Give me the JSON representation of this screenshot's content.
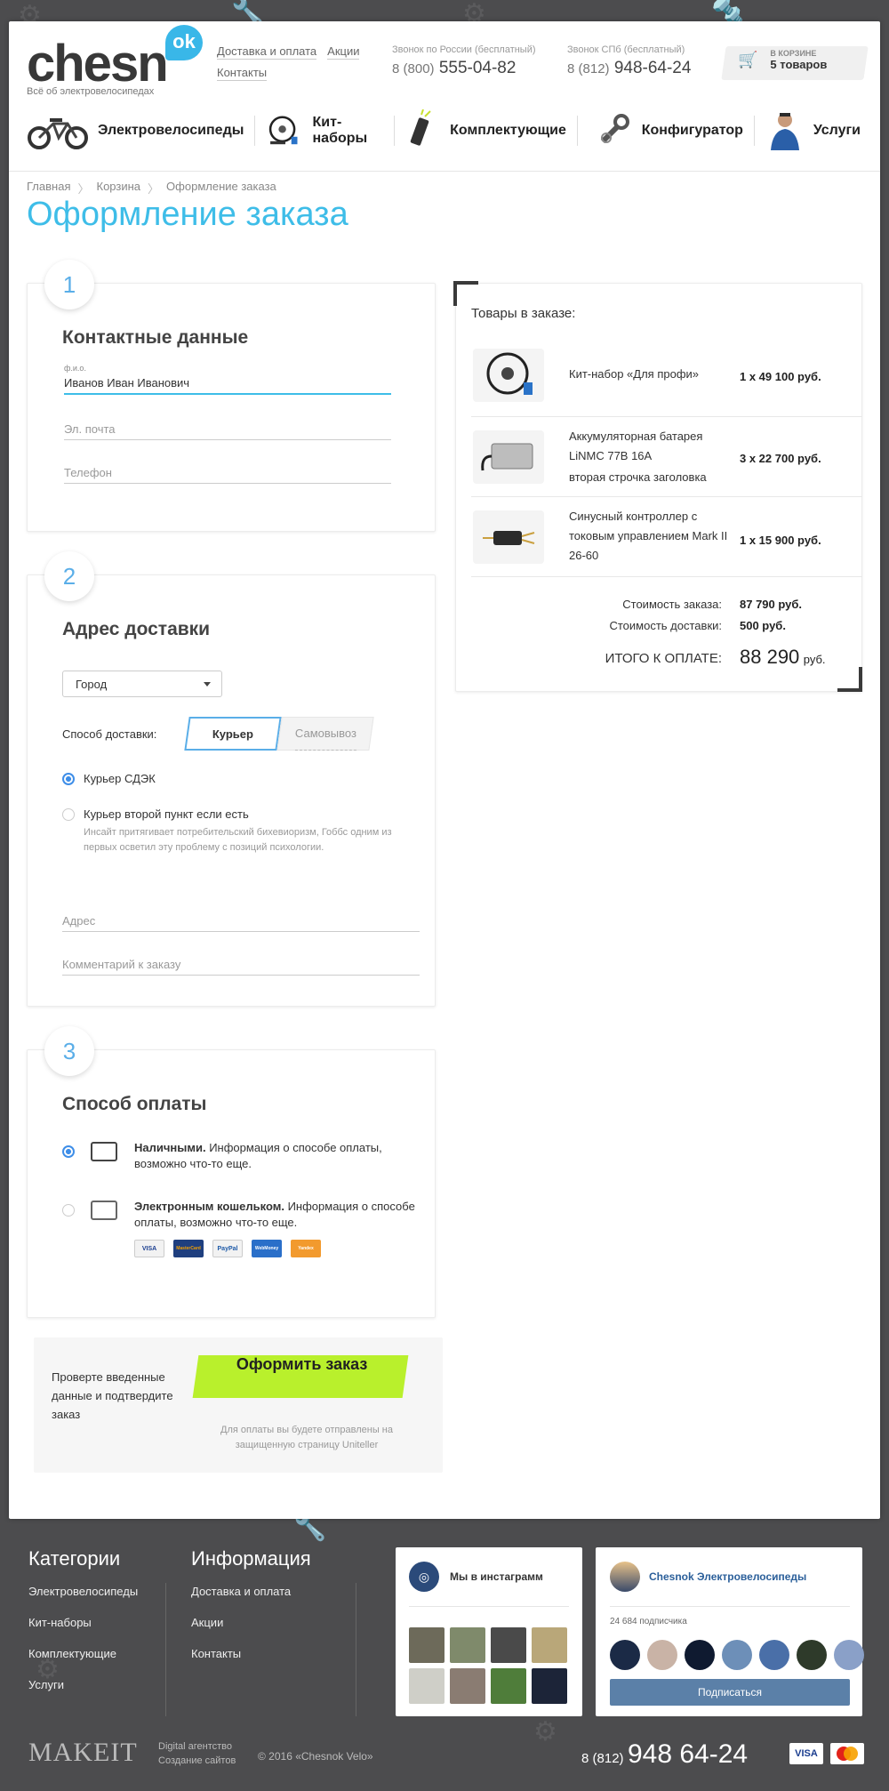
{
  "header": {
    "logo": "chesn",
    "logo_badge": "ok",
    "tagline": "Всё об электровелосипедах",
    "links": [
      "Доставка и оплата",
      "Акции",
      "Контакты"
    ],
    "phone1_caption": "Звонок по России (бесплатный)",
    "phone1_prefix": "8 (800)",
    "phone1_number": "555-04-82",
    "phone2_caption": "Звонок СПб (бесплатный)",
    "phone2_prefix": "8 (812)",
    "phone2_number": "948-64-24",
    "cart_caption": "в корзине",
    "cart_count": "5 товаров"
  },
  "nav": [
    {
      "label": "Электровелосипеды",
      "icon": "bike-icon"
    },
    {
      "label": "Кит-наборы",
      "icon": "motor-wheel-icon"
    },
    {
      "label": "Комплектующие",
      "icon": "battery-icon"
    },
    {
      "label": "Конфигуратор",
      "icon": "wrench-icon"
    },
    {
      "label": "Услуги",
      "icon": "mechanic-icon"
    }
  ],
  "breadcrumb": [
    "Главная",
    "Корзина",
    "Оформление заказа"
  ],
  "page_title": "Оформление заказа",
  "step1": {
    "num": "1",
    "title": "Контактные данные",
    "name_label": "ф.и.о.",
    "name_value": "Иванов Иван Иванович",
    "email_placeholder": "Эл. почта",
    "phone_placeholder": "Телефон"
  },
  "step2": {
    "num": "2",
    "title": "Адрес доставки",
    "city_select": "Город",
    "delivery_label": "Способ доставки:",
    "delivery_options": [
      "Курьер",
      "Самовывоз"
    ],
    "radio1": "Курьер СДЭК",
    "radio2": "Курьер второй пункт если есть",
    "radio2_desc": "Инсайт притягивает потребительский бихевиоризм, Гоббс одним из первых осветил эту проблему с позиций психологии.",
    "address_placeholder": "Адрес",
    "comment_placeholder": "Комментарий к заказу"
  },
  "step3": {
    "num": "3",
    "title": "Способ оплаты",
    "opt1_bold": "Наличными.",
    "opt1_text": " Информация о способе оплаты, возможно что-то еще.",
    "opt2_bold": "Электронным кошельком.",
    "opt2_text": " Информация о способе оплаты, возможно что-то еще.",
    "pay_logos": [
      "VISA",
      "MasterCard",
      "PayPal",
      "WebMoney",
      "Yandex"
    ]
  },
  "order": {
    "title": "Товары в заказе:",
    "items": [
      {
        "name": "Кит-набор «Для профи»",
        "price": "1 x 49 100 руб."
      },
      {
        "name": "Аккумуляторная батарея LiNMC 77В 16А",
        "name2": "вторая строчка заголовка",
        "price": "3 x 22 700 руб."
      },
      {
        "name": "Синусный контроллер с токовым управлением Mark II 26-60",
        "price": "1 x 15 900 руб."
      }
    ],
    "cost_label": "Стоимость заказа:",
    "cost_value": "87 790 руб.",
    "delivery_label": "Стоимость доставки:",
    "delivery_value": "500 руб.",
    "total_label": "ИТОГО К ОПЛАТЕ:",
    "total_value": "88 290",
    "total_unit": "руб."
  },
  "confirm": {
    "text": "Проверте введенные данные и подтвердите заказ",
    "button": "Оформить заказ",
    "note": "Для оплаты вы будете отправлены на защищенную страницу Uniteller"
  },
  "footer": {
    "categories_title": "Категории",
    "categories": [
      "Электровелосипеды",
      "Кит-наборы",
      "Комплектующие",
      "Услуги"
    ],
    "info_title": "Информация",
    "info": [
      "Доставка и оплата",
      "Акции",
      "Контакты"
    ],
    "instagram_title": "Мы в инстаграмм",
    "vk_title": "Chesnok Электровелосипеды",
    "vk_subs": "24 684 подписчика",
    "vk_button": "Подписаться",
    "makeit": "MAKEIT",
    "makeit_sub1": "Digital агентство",
    "makeit_sub2": "Создание сайтов",
    "copyright": "© 2016 «Chesnok Velo»",
    "phone_prefix": "8 (812)",
    "phone_number": "948 64-24"
  },
  "colors": {
    "accent": "#3ebde8",
    "button": "#b9f02c",
    "vk": "#5b80a8"
  }
}
